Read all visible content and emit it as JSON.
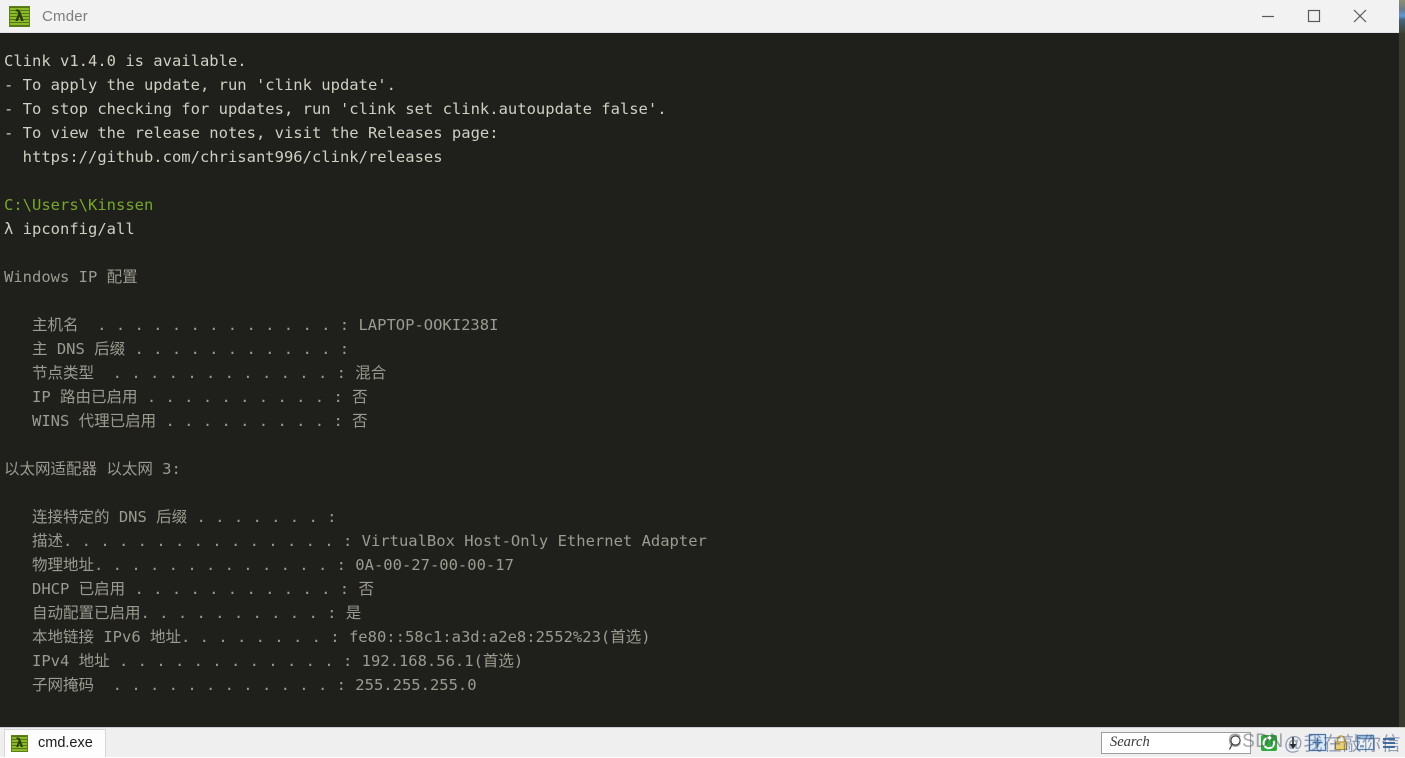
{
  "window": {
    "title": "Cmder",
    "app_icon": "lambda-icon",
    "controls": {
      "minimize": "minimize-icon",
      "maximize": "maximize-icon",
      "close": "close-icon"
    }
  },
  "terminal": {
    "background": "#1f1f1c",
    "foreground": "#cfcfc2",
    "prompt_color": "#76a82c",
    "lines": [
      {
        "text": "Clink v1.4.0 is available.",
        "color": "fg"
      },
      {
        "text": "- To apply the update, run 'clink update'.",
        "color": "fg"
      },
      {
        "text": "- To stop checking for updates, run 'clink set clink.autoupdate false'.",
        "color": "fg"
      },
      {
        "text": "- To view the release notes, visit the Releases page:",
        "color": "fg"
      },
      {
        "text": "  https://github.com/chrisant996/clink/releases",
        "color": "fg"
      },
      {
        "text": "",
        "color": "fg"
      },
      {
        "text": "C:\\Users\\Kinssen",
        "color": "green"
      },
      {
        "text": "λ ipconfig/all",
        "color": "fg"
      },
      {
        "text": "",
        "color": "fg"
      },
      {
        "text": "Windows IP 配置",
        "color": "dim"
      },
      {
        "text": "",
        "color": "fg"
      },
      {
        "text": "   主机名  . . . . . . . . . . . . . : LAPTOP-OOKI238I",
        "color": "dim"
      },
      {
        "text": "   主 DNS 后缀 . . . . . . . . . . . :",
        "color": "dim"
      },
      {
        "text": "   节点类型  . . . . . . . . . . . . : 混合",
        "color": "dim"
      },
      {
        "text": "   IP 路由已启用 . . . . . . . . . . : 否",
        "color": "dim"
      },
      {
        "text": "   WINS 代理已启用 . . . . . . . . . : 否",
        "color": "dim"
      },
      {
        "text": "",
        "color": "fg"
      },
      {
        "text": "以太网适配器 以太网 3:",
        "color": "dim"
      },
      {
        "text": "",
        "color": "fg"
      },
      {
        "text": "   连接特定的 DNS 后缀 . . . . . . . :",
        "color": "dim"
      },
      {
        "text": "   描述. . . . . . . . . . . . . . . : VirtualBox Host-Only Ethernet Adapter",
        "color": "dim"
      },
      {
        "text": "   物理地址. . . . . . . . . . . . . : 0A-00-27-00-00-17",
        "color": "dim"
      },
      {
        "text": "   DHCP 已启用 . . . . . . . . . . . : 否",
        "color": "dim"
      },
      {
        "text": "   自动配置已启用. . . . . . . . . . : 是",
        "color": "dim"
      },
      {
        "text": "   本地链接 IPv6 地址. . . . . . . . : fe80::58c1:a3d:a2e8:2552%23(首选)",
        "color": "dim"
      },
      {
        "text": "   IPv4 地址 . . . . . . . . . . . . : 192.168.56.1(首选)",
        "color": "dim"
      },
      {
        "text": "   子网掩码  . . . . . . . . . . . . : 255.255.255.0",
        "color": "dim"
      }
    ]
  },
  "statusbar": {
    "tabs": [
      {
        "label": "cmd.exe",
        "icon": "lambda-icon",
        "active": true
      }
    ],
    "search": {
      "placeholder": "Search",
      "value": "",
      "icon": "search-icon"
    },
    "icons": [
      "refresh-green-icon",
      "arrow-down-icon",
      "new-console-icon",
      "lock-icon",
      "window-icon",
      "menu-icon"
    ]
  },
  "watermark": {
    "prefix": "CSDN",
    "text": "@我在敲你信"
  }
}
